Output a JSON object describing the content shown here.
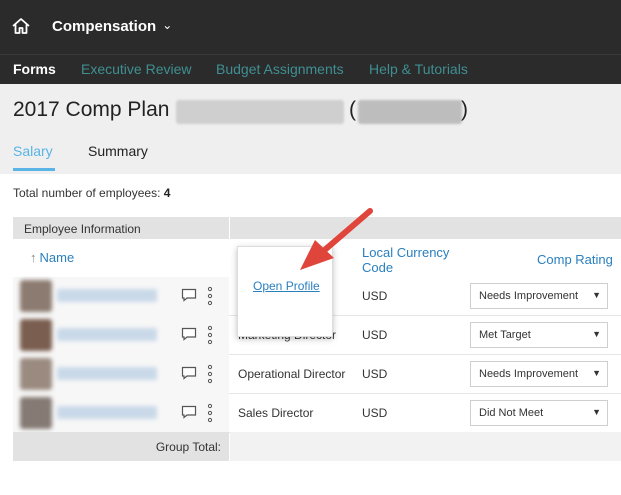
{
  "topbar": {
    "module_label": "Compensation",
    "chevron": "chevron-down-icon",
    "home_icon": "home-icon"
  },
  "nav": {
    "tabs": [
      "Forms",
      "Executive Review",
      "Budget Assignments",
      "Help & Tutorials"
    ],
    "active": "Forms"
  },
  "page": {
    "title": "2017 Comp Plan",
    "paren_open": "(",
    "paren_close": ")"
  },
  "subtabs": {
    "salary": "Salary",
    "summary": "Summary",
    "active": "Salary"
  },
  "employees": {
    "label": "Total number of employees:",
    "count": "4"
  },
  "table": {
    "group_header": "Employee Information",
    "col_name": "Name",
    "col_lcc": "Local Currency Code",
    "col_comp": "Comp Rating",
    "rows": [
      {
        "title": "",
        "currency": "USD",
        "rating": "Needs Improvement"
      },
      {
        "title": "Marketing Director",
        "currency": "USD",
        "rating": "Met Target"
      },
      {
        "title": "Operational Director",
        "currency": "USD",
        "rating": "Needs Improvement"
      },
      {
        "title": "Sales Director",
        "currency": "USD",
        "rating": "Did Not Meet"
      }
    ],
    "group_total": "Group Total:"
  },
  "popup": {
    "link": "Open Profile"
  },
  "colors": {
    "accent": "#5ab4e5",
    "link": "#2a7fbf",
    "nav_inactive": "#3f8f92",
    "annotation": "#e0453c"
  }
}
